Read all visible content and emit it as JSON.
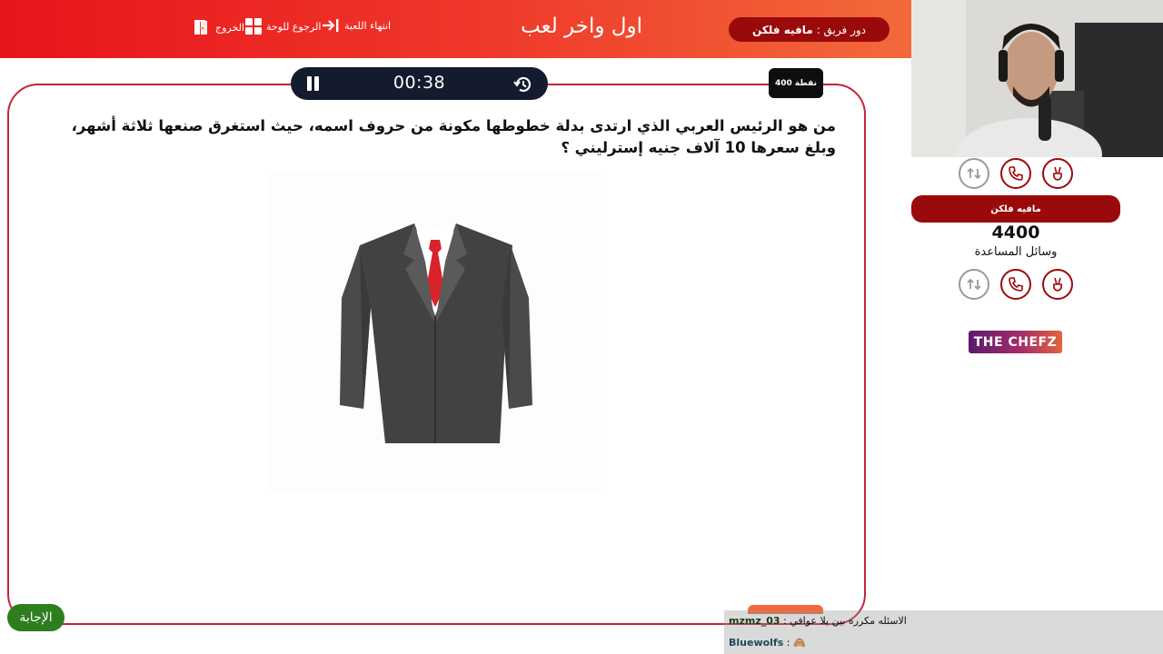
{
  "header": {
    "exit_label": "الخروج",
    "board_label": "الرجوع للوحة",
    "end_label": "انتهاء اللعبة",
    "title": "اول واخر لعب",
    "turn_prefix": "دور فريق :",
    "turn_team": "مافيه فلكن"
  },
  "question_card": {
    "timer": "00:38",
    "points": "400 نقطة",
    "question": "من هو الرئيس العربي الذي ارتدى بدلة خطوطها مكونة من حروف اسمه، حيث استغرق صنعها ثلاثة أشهر، وبلغ سعرها 10 آلاف جنيه إسترليني ؟",
    "answer_button": "الإجابة"
  },
  "side_panel": {
    "team_name": "مافيه فلكن",
    "score": "4400",
    "helps_label": "وسائل المساعدة",
    "logo_text": "THE CHEFZ"
  },
  "chat": {
    "messages": [
      {
        "user": "mzmz_03",
        "text": ": الاسئله مكرره بين يلا عوافي"
      },
      {
        "user": "Bluewolfs",
        "text": ": 🙈"
      }
    ]
  },
  "colors": {
    "header_start": "#e8141c",
    "header_end": "#f26a3a",
    "team_red": "#9a0a0a",
    "card_border": "#c0263a",
    "timer_bg": "#141b2e",
    "answer_green": "#2e7d1e"
  },
  "icons": [
    "door-exit-icon",
    "grid-board-icon",
    "arrow-end-icon",
    "pause-icon",
    "history-reset-icon",
    "swap-lifeline-icon",
    "phone-lifeline-icon",
    "peace-hand-lifeline-icon",
    "suit-jacket-image"
  ]
}
